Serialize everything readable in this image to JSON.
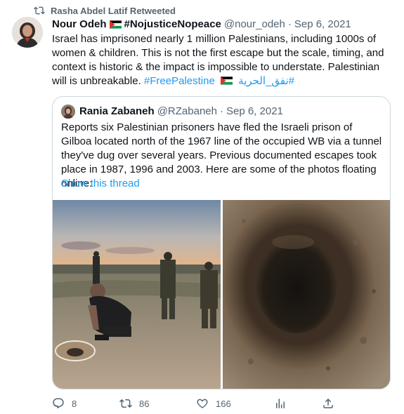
{
  "retweet_label": "Rasha Abdel Latif Retweeted",
  "tweet": {
    "name": "Nour Odeh",
    "name_suffix": "#NojusticeNopeace",
    "handle": "@nour_odeh",
    "separator": "·",
    "date": "Sep 6, 2021",
    "text_main": "Israel has imprisoned nearly 1 million Palestinians, including 1000s of women & children. This is not the first escape but the scale, timing, and context is historic & the impact is impossible to understate. Palestinian will is unbreakable.",
    "hashtag_1": "#FreePalestine",
    "hashtag_2": "#نفق_الحرية"
  },
  "quote": {
    "name": "Rania Zabaneh",
    "handle": "@RZabaneh",
    "separator": "·",
    "date": "Sep 6, 2021",
    "text": "Reports six Palestinian prisoners have fled the Israeli prison of Gilboa located north of the 1967 line of the occupied WB via a tunnel they've dug over several years. Previous documented escapes took place in 1987, 1996 and 2003. Here are some of the photos floating online:",
    "show_thread": "Show this thread"
  },
  "actions": {
    "replies": "8",
    "retweets": "86",
    "likes": "166"
  },
  "colors": {
    "link": "#1d9bf0",
    "secondary": "#536471",
    "border": "#cfd9de"
  }
}
